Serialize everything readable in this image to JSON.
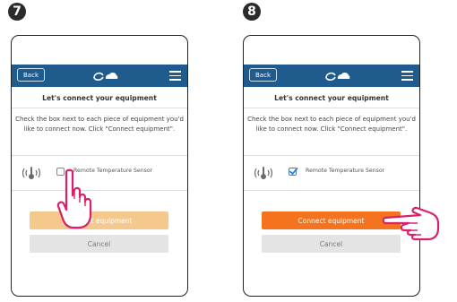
{
  "steps": [
    {
      "number": "7",
      "app": {
        "back_label": "Back",
        "title": "Let's connect your equipment",
        "description": "Check the box next to each piece of equipment you'd like to connect now. Click \"Connect equipment\".",
        "equipment": {
          "name": "Remote Temperature Sensor",
          "checked": false
        },
        "connect_label": "Connect equipment",
        "connect_state": "disabled",
        "cancel_label": "Cancel"
      },
      "hand_target": "checkbox"
    },
    {
      "number": "8",
      "app": {
        "back_label": "Back",
        "title": "Let's connect your equipment",
        "description": "Check the box next to each piece of equipment you'd like to connect now. Click \"Connect equipment\".",
        "equipment": {
          "name": "Remote Temperature Sensor",
          "checked": true
        },
        "connect_label": "Connect equipment",
        "connect_state": "active",
        "cancel_label": "Cancel"
      },
      "hand_target": "connect-button"
    }
  ],
  "colors": {
    "appbar": "#1f5b8c",
    "connect_active": "#f4731f",
    "connect_disabled": "#f5c98e",
    "cancel": "#e4e4e4",
    "hand_outline": "#d8206c",
    "checkbox_checked": "#3a7fc1"
  },
  "icons": {
    "logo": "cloud-logo-icon",
    "menu": "hamburger-menu-icon",
    "sensor": "wireless-sensor-icon",
    "pointer": "pointing-hand-icon"
  }
}
